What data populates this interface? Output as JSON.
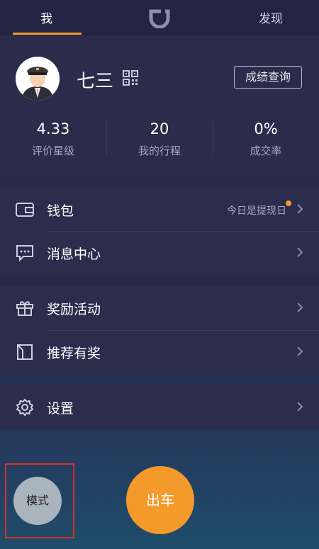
{
  "tabs": {
    "me": "我",
    "discover": "发现"
  },
  "profile": {
    "name": "七三",
    "score_button": "成绩查询",
    "stats": [
      {
        "value": "4.33",
        "label": "评价星级"
      },
      {
        "value": "20",
        "label": "我的行程"
      },
      {
        "value": "0%",
        "label": "成交率"
      }
    ]
  },
  "menu": {
    "wallet": {
      "label": "钱包",
      "hint": "今日是提现日"
    },
    "messages": {
      "label": "消息中心"
    },
    "rewards": {
      "label": "奖励活动"
    },
    "referral": {
      "label": "推荐有奖"
    },
    "settings": {
      "label": "设置"
    }
  },
  "actions": {
    "mode": "模式",
    "go": "出车"
  },
  "colors": {
    "accent": "#f39a2a",
    "highlight": "#d9302a"
  }
}
